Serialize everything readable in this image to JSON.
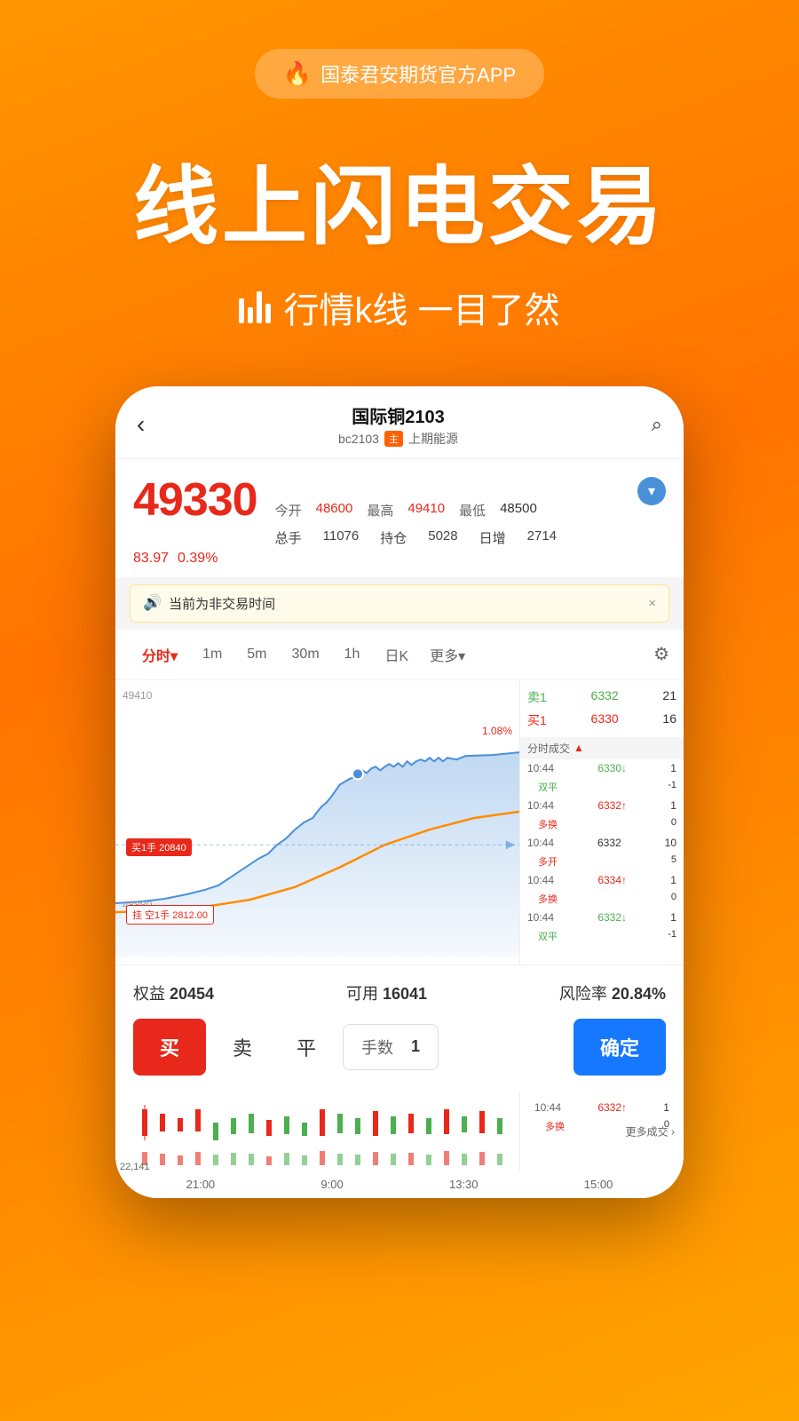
{
  "app": {
    "banner_icon": "🔥",
    "banner_text": "国泰君安期货官方APP"
  },
  "hero": {
    "title": "线上闪电交易",
    "subtitle": "行情k线 一目了然"
  },
  "phone": {
    "header": {
      "back_label": "‹",
      "title": "国际铜2103",
      "subtitle": "bc2103",
      "tag": "主",
      "exchange": "上期能源",
      "search_icon": "🔍"
    },
    "price": {
      "main": "49330",
      "today_open_label": "今开",
      "today_open": "48600",
      "high_label": "最高",
      "high": "49410",
      "low_label": "最低",
      "low": "48500",
      "change_abs": "83.97",
      "change_pct": "0.39%",
      "total_hand_label": "总手",
      "total_hand": "11076",
      "hold_label": "持仓",
      "hold": "5028",
      "day_inc_label": "日增",
      "day_inc": "2714"
    },
    "alert": {
      "text": "当前为非交易时间",
      "close": "×"
    },
    "tabs": [
      "分时",
      "1m",
      "5m",
      "30m",
      "1h",
      "日K",
      "更多"
    ],
    "chart": {
      "high_label": "49410",
      "low_label": "48880",
      "change_pct": "1.08%",
      "buy_tag": "买1手 20840",
      "sell_tag": "挂 空1手 2812.00"
    },
    "orderbook": {
      "sell_label": "卖1",
      "sell_price": "6332",
      "sell_qty": "21",
      "buy_label": "买1",
      "buy_price": "6330",
      "buy_qty": "16",
      "section_label": "分时成交"
    },
    "trades": [
      {
        "time": "10:44",
        "price": "6330",
        "direction": "down",
        "qty": "1",
        "type": "双平",
        "change": "-1"
      },
      {
        "time": "10:44",
        "price": "6332",
        "direction": "up",
        "qty": "1",
        "type": "多换",
        "change": "0"
      },
      {
        "time": "10:44",
        "price": "6332",
        "direction": "neutral",
        "qty": "10",
        "type": "多开",
        "change": "5"
      },
      {
        "time": "10:44",
        "price": "6334",
        "direction": "up",
        "qty": "1",
        "type": "多换",
        "change": "0"
      },
      {
        "time": "10:44",
        "price": "6332",
        "direction": "down",
        "qty": "1",
        "type": "双平",
        "change": "-1"
      }
    ],
    "equity": {
      "rights_label": "权益",
      "rights_val": "20454",
      "available_label": "可用",
      "available_val": "16041",
      "risk_label": "风险率",
      "risk_val": "20.84%"
    },
    "trading": {
      "buy_label": "买",
      "sell_label": "卖",
      "flat_label": "平",
      "qty_label": "手数",
      "qty_val": "1",
      "confirm_label": "确定"
    },
    "bottom_times": [
      "21:00",
      "9:00",
      "13:30",
      "15:00"
    ],
    "more_trades": "更多成交 ›"
  }
}
